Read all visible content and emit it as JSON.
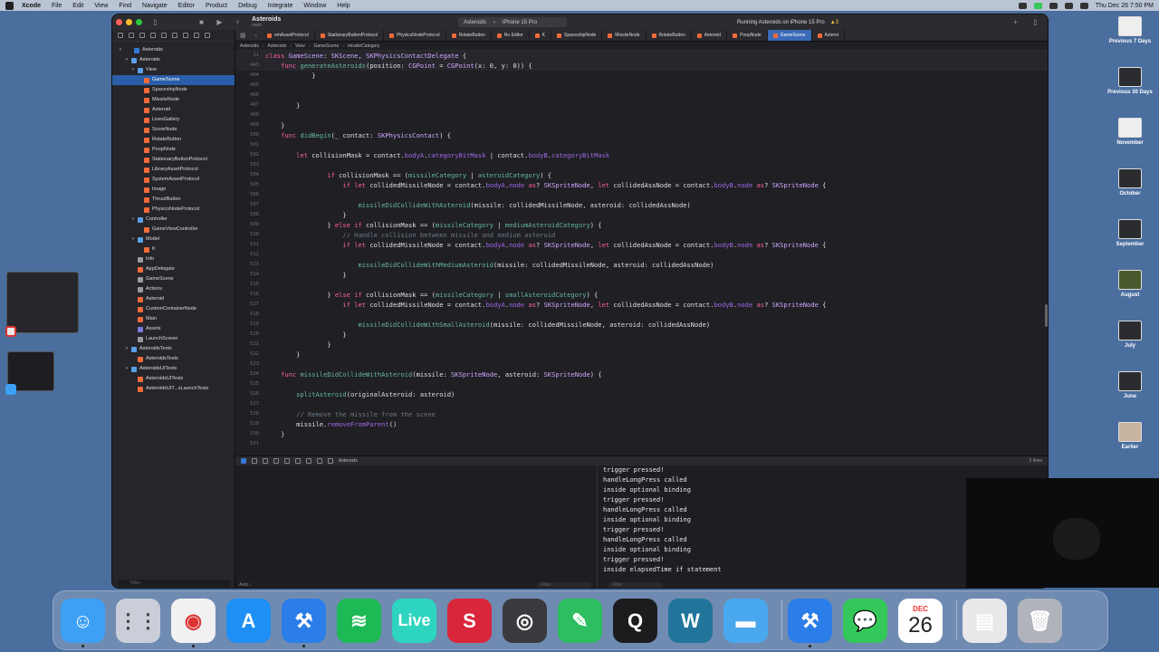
{
  "menubar": {
    "app": "Xcode",
    "items": [
      "File",
      "Edit",
      "View",
      "Find",
      "Navigate",
      "Editor",
      "Product",
      "Debug",
      "Integrate",
      "Window",
      "Help"
    ],
    "clock": "Thu Dec 26  7:50 PM"
  },
  "toolbar": {
    "project": "Asteroids",
    "branch": "main",
    "scheme": "Asteroids",
    "device": "iPhone 15 Pro",
    "status": "Running Asteroids on iPhone 15 Pro",
    "warnings": "▲3"
  },
  "sidebar": {
    "items": [
      {
        "label": "Asteroids",
        "indent": 0,
        "kind": "proj",
        "chev": "▾"
      },
      {
        "label": "Asteroids",
        "indent": 1,
        "kind": "folder",
        "chev": "▾"
      },
      {
        "label": "View",
        "indent": 2,
        "kind": "folder",
        "chev": "▾"
      },
      {
        "label": "GameScene",
        "indent": 3,
        "kind": "swift",
        "selected": true
      },
      {
        "label": "SpaceshipNode",
        "indent": 3,
        "kind": "swift"
      },
      {
        "label": "MissileNode",
        "indent": 3,
        "kind": "swift"
      },
      {
        "label": "Asteroid",
        "indent": 3,
        "kind": "swift"
      },
      {
        "label": "LivesGallery",
        "indent": 3,
        "kind": "swift"
      },
      {
        "label": "ScoreNode",
        "indent": 3,
        "kind": "swift"
      },
      {
        "label": "RotateButton",
        "indent": 3,
        "kind": "swift"
      },
      {
        "label": "PoopNode",
        "indent": 3,
        "kind": "swift"
      },
      {
        "label": "StationaryButtonProtocol",
        "indent": 3,
        "kind": "swift"
      },
      {
        "label": "LibraryAssetProtocol",
        "indent": 3,
        "kind": "swift"
      },
      {
        "label": "SystemAssetProtocol",
        "indent": 3,
        "kind": "swift"
      },
      {
        "label": "Image",
        "indent": 3,
        "kind": "swift"
      },
      {
        "label": "ThrustButton",
        "indent": 3,
        "kind": "swift"
      },
      {
        "label": "PhysicsNodeProtocol",
        "indent": 3,
        "kind": "swift"
      },
      {
        "label": "Controller",
        "indent": 2,
        "kind": "folder",
        "chev": "▾"
      },
      {
        "label": "GameViewController",
        "indent": 3,
        "kind": "swift"
      },
      {
        "label": "Model",
        "indent": 2,
        "kind": "folder",
        "chev": "▾"
      },
      {
        "label": "K",
        "indent": 3,
        "kind": "swift"
      },
      {
        "label": "Info",
        "indent": 2,
        "kind": "file"
      },
      {
        "label": "AppDelegate",
        "indent": 2,
        "kind": "swift"
      },
      {
        "label": "GameScene",
        "indent": 2,
        "kind": "file"
      },
      {
        "label": "Actions",
        "indent": 2,
        "kind": "file"
      },
      {
        "label": "Asteroid",
        "indent": 2,
        "kind": "swift"
      },
      {
        "label": "CustomContainerNode",
        "indent": 2,
        "kind": "swift"
      },
      {
        "label": "Main",
        "indent": 2,
        "kind": "swift"
      },
      {
        "label": "Assets",
        "indent": 2,
        "kind": "asset"
      },
      {
        "label": "LaunchScreen",
        "indent": 2,
        "kind": "file"
      },
      {
        "label": "AsteroidsTests",
        "indent": 1,
        "kind": "folder",
        "chev": "▾"
      },
      {
        "label": "AsteroidsTests",
        "indent": 2,
        "kind": "swift"
      },
      {
        "label": "AsteroidsUITests",
        "indent": 1,
        "kind": "folder",
        "chev": "▾"
      },
      {
        "label": "AsteroidsUITests",
        "indent": 2,
        "kind": "swift"
      },
      {
        "label": "AsteroidsUIT...sLaunchTests",
        "indent": 2,
        "kind": "swift"
      }
    ],
    "filter_placeholder": "Filter"
  },
  "tabs": [
    "emAssetProtocol",
    "StationaryButtonProtocol",
    "PhysicsNodeProtocol",
    "RotateButton",
    "No Editor",
    "K",
    "SpaceshipNode",
    "MissileNode",
    "RotateButton",
    "Asteroid",
    "PoopNode",
    "GameScene",
    "Asteroi"
  ],
  "active_tab": "GameScene",
  "jumpbar": [
    "Asteroids",
    "Asteroids",
    "View",
    "GameScene",
    "missileCategory"
  ],
  "code": [
    {
      "n": "11",
      "sticky": true,
      "t": [
        [
          "kw",
          "class "
        ],
        [
          "ty",
          "GameScene"
        ],
        [
          "id",
          ": "
        ],
        [
          "ty",
          "SKScene"
        ],
        [
          "id",
          ", "
        ],
        [
          "ty",
          "SKPhysicsContactDelegate"
        ],
        [
          "id",
          " {"
        ]
      ]
    },
    {
      "n": "443",
      "sticky": true,
      "t": [
        [
          "id",
          "    "
        ],
        [
          "kw",
          "func "
        ],
        [
          "fn",
          "generateAsteroids"
        ],
        [
          "id",
          "(position: "
        ],
        [
          "ty",
          "CGPoint"
        ],
        [
          "id",
          " = "
        ],
        [
          "ty",
          "CGPoint"
        ],
        [
          "id",
          "(x: 0, y: 0)) {"
        ]
      ]
    },
    {
      "n": "494",
      "t": [
        [
          "id",
          "            }"
        ]
      ]
    },
    {
      "n": "495",
      "t": []
    },
    {
      "n": "496",
      "t": []
    },
    {
      "n": "497",
      "t": [
        [
          "id",
          "        }"
        ]
      ]
    },
    {
      "n": "498",
      "t": []
    },
    {
      "n": "499",
      "t": [
        [
          "id",
          "    }"
        ]
      ]
    },
    {
      "n": "500",
      "t": [
        [
          "id",
          "    "
        ],
        [
          "kw",
          "func "
        ],
        [
          "fn",
          "didBegin"
        ],
        [
          "id",
          "(_ contact: "
        ],
        [
          "ty",
          "SKPhysicsContact"
        ],
        [
          "id",
          ") {"
        ]
      ]
    },
    {
      "n": "501",
      "t": []
    },
    {
      "n": "502",
      "t": [
        [
          "id",
          "        "
        ],
        [
          "kw",
          "let "
        ],
        [
          "id",
          "collisionMask = contact."
        ],
        [
          "pr",
          "bodyA"
        ],
        [
          "id",
          "."
        ],
        [
          "pr",
          "categoryBitMask"
        ],
        [
          "id",
          " | contact."
        ],
        [
          "pr",
          "bodyB"
        ],
        [
          "id",
          "."
        ],
        [
          "pr",
          "categoryBitMask"
        ]
      ]
    },
    {
      "n": "503",
      "t": []
    },
    {
      "n": "504",
      "t": [
        [
          "id",
          "                "
        ],
        [
          "kw",
          "if "
        ],
        [
          "id",
          "collisionMask == ("
        ],
        [
          "fn",
          "missileCategory"
        ],
        [
          "id",
          " | "
        ],
        [
          "fn",
          "asteroidCategory"
        ],
        [
          "id",
          ") {"
        ]
      ]
    },
    {
      "n": "505",
      "t": [
        [
          "id",
          "                    "
        ],
        [
          "kw",
          "if let "
        ],
        [
          "id",
          "collidedMissileNode = contact."
        ],
        [
          "pr",
          "bodyA"
        ],
        [
          "id",
          "."
        ],
        [
          "pr",
          "node"
        ],
        [
          "id",
          " "
        ],
        [
          "kw",
          "as"
        ],
        [
          "id",
          "? "
        ],
        [
          "ty",
          "SKSpriteNode"
        ],
        [
          "id",
          ", "
        ],
        [
          "kw",
          "let "
        ],
        [
          "id",
          "collidedAssNode = contact."
        ],
        [
          "pr",
          "bodyB"
        ],
        [
          "id",
          "."
        ],
        [
          "pr",
          "node"
        ],
        [
          "id",
          " "
        ],
        [
          "kw",
          "as"
        ],
        [
          "id",
          "? "
        ],
        [
          "ty",
          "SKSpriteNode"
        ],
        [
          "id",
          " {"
        ]
      ]
    },
    {
      "n": "506",
      "t": []
    },
    {
      "n": "507",
      "t": [
        [
          "id",
          "                        "
        ],
        [
          "fn",
          "missileDidCollideWithAsteroid"
        ],
        [
          "id",
          "(missile: collidedMissileNode, asteroid: collidedAssNode)"
        ]
      ]
    },
    {
      "n": "508",
      "t": [
        [
          "id",
          "                    }"
        ]
      ]
    },
    {
      "n": "509",
      "t": [
        [
          "id",
          "                } "
        ],
        [
          "kw",
          "else if "
        ],
        [
          "id",
          "collisionMask == ("
        ],
        [
          "fn",
          "missileCategory"
        ],
        [
          "id",
          " | "
        ],
        [
          "fn",
          "mediumAsteroidCategory"
        ],
        [
          "id",
          ") {"
        ]
      ]
    },
    {
      "n": "510",
      "t": [
        [
          "id",
          "                    "
        ],
        [
          "cm",
          "// Handle collision between missile and medium asteroid"
        ]
      ]
    },
    {
      "n": "511",
      "t": [
        [
          "id",
          "                    "
        ],
        [
          "kw",
          "if let "
        ],
        [
          "id",
          "collidedMissileNode = contact."
        ],
        [
          "pr",
          "bodyA"
        ],
        [
          "id",
          "."
        ],
        [
          "pr",
          "node"
        ],
        [
          "id",
          " "
        ],
        [
          "kw",
          "as"
        ],
        [
          "id",
          "? "
        ],
        [
          "ty",
          "SKSpriteNode"
        ],
        [
          "id",
          ", "
        ],
        [
          "kw",
          "let "
        ],
        [
          "id",
          "collidedAssNode = contact."
        ],
        [
          "pr",
          "bodyB"
        ],
        [
          "id",
          "."
        ],
        [
          "pr",
          "node"
        ],
        [
          "id",
          " "
        ],
        [
          "kw",
          "as"
        ],
        [
          "id",
          "? "
        ],
        [
          "ty",
          "SKSpriteNode"
        ],
        [
          "id",
          " {"
        ]
      ]
    },
    {
      "n": "512",
      "t": []
    },
    {
      "n": "513",
      "t": [
        [
          "id",
          "                        "
        ],
        [
          "fn",
          "missileDidCollideWithMediumAsteroid"
        ],
        [
          "id",
          "(missile: collidedMissileNode, asteroid: collidedAssNode)"
        ]
      ]
    },
    {
      "n": "514",
      "t": [
        [
          "id",
          "                    }"
        ]
      ]
    },
    {
      "n": "515",
      "t": []
    },
    {
      "n": "516",
      "t": [
        [
          "id",
          "                } "
        ],
        [
          "kw",
          "else if "
        ],
        [
          "id",
          "collisionMask == ("
        ],
        [
          "fn",
          "missileCategory"
        ],
        [
          "id",
          " | "
        ],
        [
          "fn",
          "smallAsteroidCategory"
        ],
        [
          "id",
          ") {"
        ]
      ]
    },
    {
      "n": "517",
      "t": [
        [
          "id",
          "                    "
        ],
        [
          "kw",
          "if let "
        ],
        [
          "id",
          "collidedMissileNode = contact."
        ],
        [
          "pr",
          "bodyA"
        ],
        [
          "id",
          "."
        ],
        [
          "pr",
          "node"
        ],
        [
          "id",
          " "
        ],
        [
          "kw",
          "as"
        ],
        [
          "id",
          "? "
        ],
        [
          "ty",
          "SKSpriteNode"
        ],
        [
          "id",
          ", "
        ],
        [
          "kw",
          "let "
        ],
        [
          "id",
          "collidedAssNode = contact."
        ],
        [
          "pr",
          "bodyB"
        ],
        [
          "id",
          "."
        ],
        [
          "pr",
          "node"
        ],
        [
          "id",
          " "
        ],
        [
          "kw",
          "as"
        ],
        [
          "id",
          "? "
        ],
        [
          "ty",
          "SKSpriteNode"
        ],
        [
          "id",
          " {"
        ]
      ]
    },
    {
      "n": "518",
      "t": []
    },
    {
      "n": "519",
      "t": [
        [
          "id",
          "                        "
        ],
        [
          "fn",
          "missileDidCollideWithSmallAsteroid"
        ],
        [
          "id",
          "(missile: collidedMissileNode, asteroid: collidedAssNode)"
        ]
      ]
    },
    {
      "n": "520",
      "t": [
        [
          "id",
          "                    }"
        ]
      ]
    },
    {
      "n": "521",
      "t": [
        [
          "id",
          "                }"
        ]
      ]
    },
    {
      "n": "522",
      "t": [
        [
          "id",
          "        }"
        ]
      ]
    },
    {
      "n": "523",
      "t": []
    },
    {
      "n": "524",
      "t": [
        [
          "id",
          "    "
        ],
        [
          "kw",
          "func "
        ],
        [
          "fn",
          "missileDidCollideWithAsteroid"
        ],
        [
          "id",
          "(missile: "
        ],
        [
          "ty",
          "SKSpriteNode"
        ],
        [
          "id",
          ", asteroid: "
        ],
        [
          "ty",
          "SKSpriteNode"
        ],
        [
          "id",
          ") {"
        ]
      ]
    },
    {
      "n": "525",
      "t": []
    },
    {
      "n": "526",
      "t": [
        [
          "id",
          "        "
        ],
        [
          "fn",
          "splitAsteroid"
        ],
        [
          "id",
          "(originalAsteroid: asteroid)"
        ]
      ]
    },
    {
      "n": "527",
      "t": []
    },
    {
      "n": "528",
      "t": [
        [
          "id",
          "        "
        ],
        [
          "cm",
          "// Remove the missile from the scene"
        ]
      ]
    },
    {
      "n": "529",
      "t": [
        [
          "id",
          "        missile."
        ],
        [
          "pr",
          "removeFromParent"
        ],
        [
          "id",
          "()"
        ]
      ]
    },
    {
      "n": "530",
      "t": [
        [
          "id",
          "    }"
        ]
      ]
    },
    {
      "n": "531",
      "t": []
    }
  ],
  "debugbar": {
    "target": "Asteroids",
    "lines": "2 lines"
  },
  "console": [
    "trigger pressed!",
    "handleLongPress called",
    "inside optional binding",
    "trigger pressed!",
    "handleLongPress called",
    "inside optional binding",
    "trigger pressed!",
    "handleLongPress called",
    "inside optional binding",
    "trigger pressed!",
    "inside elapsedTime if statement"
  ],
  "vars_footer": {
    "mode": "Auto ↕",
    "filter": "Filter"
  },
  "console_footer": {
    "filter": "Filter"
  },
  "desktop": [
    {
      "label": "Previous 7 Days",
      "img": "white"
    },
    {
      "label": "Previous 30 Days",
      "img": "dark"
    },
    {
      "label": "November",
      "img": "white"
    },
    {
      "label": "October",
      "img": "dark"
    },
    {
      "label": "September",
      "img": "dark"
    },
    {
      "label": "August",
      "img": "land"
    },
    {
      "label": "July",
      "img": "dark"
    },
    {
      "label": "June",
      "img": "dark"
    },
    {
      "label": "Earlier",
      "img": "face"
    }
  ],
  "dock": {
    "apps": [
      {
        "name": "finder",
        "bg": "#3da0f5",
        "glyph": "☺",
        "running": true
      },
      {
        "name": "launchpad",
        "bg": "#c9ced8",
        "glyph": "⋮⋮",
        "running": false
      },
      {
        "name": "chrome",
        "bg": "#f1f1f1",
        "glyph": "◉",
        "running": true
      },
      {
        "name": "app-store",
        "bg": "#1e8ff5",
        "glyph": "A",
        "running": false
      },
      {
        "name": "xcode",
        "bg": "#2b7de9",
        "glyph": "⚒",
        "running": true
      },
      {
        "name": "spotify",
        "bg": "#1db954",
        "glyph": "≋",
        "running": false
      },
      {
        "name": "live",
        "bg": "#2dd4bf",
        "glyph": "Live",
        "running": false
      },
      {
        "name": "scrivener",
        "bg": "#d9263a",
        "glyph": "S",
        "running": false
      },
      {
        "name": "logic",
        "bg": "#3a3a3e",
        "glyph": "◎",
        "running": false
      },
      {
        "name": "evernote",
        "bg": "#2dbe60",
        "glyph": "✎",
        "running": false
      },
      {
        "name": "quicktime",
        "bg": "#1c1c1e",
        "glyph": "Q",
        "running": false
      },
      {
        "name": "wordpress",
        "bg": "#21759b",
        "glyph": "W",
        "running": false
      },
      {
        "name": "folder",
        "bg": "#4aa8ee",
        "glyph": "▬",
        "running": false
      },
      {
        "name": "simulator",
        "bg": "#2b7de9",
        "glyph": "⚒",
        "running": true
      },
      {
        "name": "messages",
        "bg": "#34c759",
        "glyph": "💬",
        "running": false
      },
      {
        "name": "calendar",
        "bg": "#ffffff",
        "glyph": "26",
        "running": false
      },
      {
        "name": "downloads",
        "bg": "#e8e8ea",
        "glyph": "▤",
        "running": false
      },
      {
        "name": "trash",
        "bg": "#b0b4ba",
        "glyph": "🗑",
        "running": false
      }
    ],
    "calendar_month": "DEC",
    "calendar_day": "26"
  }
}
